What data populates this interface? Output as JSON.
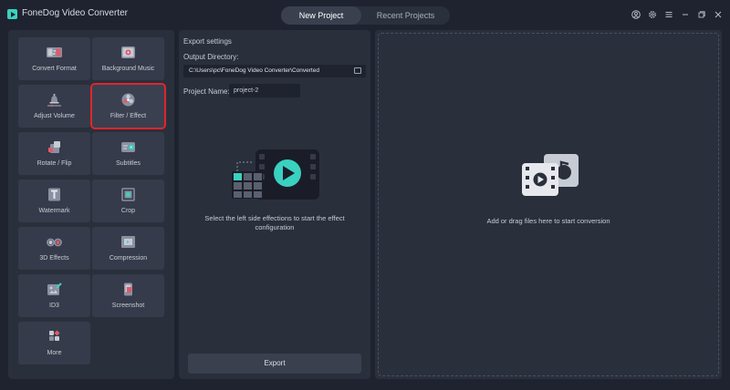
{
  "app": {
    "title": "FoneDog Video Converter"
  },
  "tabs": [
    {
      "label": "New Project",
      "active": true
    },
    {
      "label": "Recent Projects",
      "active": false
    }
  ],
  "window_controls": [
    "user-icon",
    "settings-icon",
    "menu-icon",
    "minimize-icon",
    "restore-icon",
    "close-icon"
  ],
  "tools": [
    {
      "label": "Convert Format",
      "icon": "convert-format-icon"
    },
    {
      "label": "Background Music",
      "icon": "background-music-icon"
    },
    {
      "label": "Adjust Volume",
      "icon": "adjust-volume-icon"
    },
    {
      "label": "Filter / Effect",
      "icon": "filter-effect-icon",
      "selected": true
    },
    {
      "label": "Rotate / Flip",
      "icon": "rotate-flip-icon"
    },
    {
      "label": "Subtitles",
      "icon": "subtitles-icon"
    },
    {
      "label": "Watermark",
      "icon": "watermark-icon"
    },
    {
      "label": "Crop",
      "icon": "crop-icon"
    },
    {
      "label": "3D Effects",
      "icon": "3d-effects-icon"
    },
    {
      "label": "Compression",
      "icon": "compression-icon"
    },
    {
      "label": "ID3",
      "icon": "id3-icon"
    },
    {
      "label": "Screenshot",
      "icon": "screenshot-icon"
    },
    {
      "label": "More",
      "icon": "more-icon"
    }
  ],
  "export": {
    "title": "Export settings",
    "output_directory_label": "Output Directory:",
    "output_directory_value": "C:\\Users\\pc\\FoneDog Video Converter\\Converted",
    "project_name_label": "Project Name:",
    "project_name_value": "project-2",
    "hint": "Select the left side effections to start the effect configuration",
    "export_label": "Export"
  },
  "drop": {
    "hint": "Add or drag files here to start conversion"
  },
  "colors": {
    "accent": "#3ad1c0",
    "selected_outline": "#e0262b",
    "background": "#1f2330",
    "panel": "#2a2f3c"
  }
}
